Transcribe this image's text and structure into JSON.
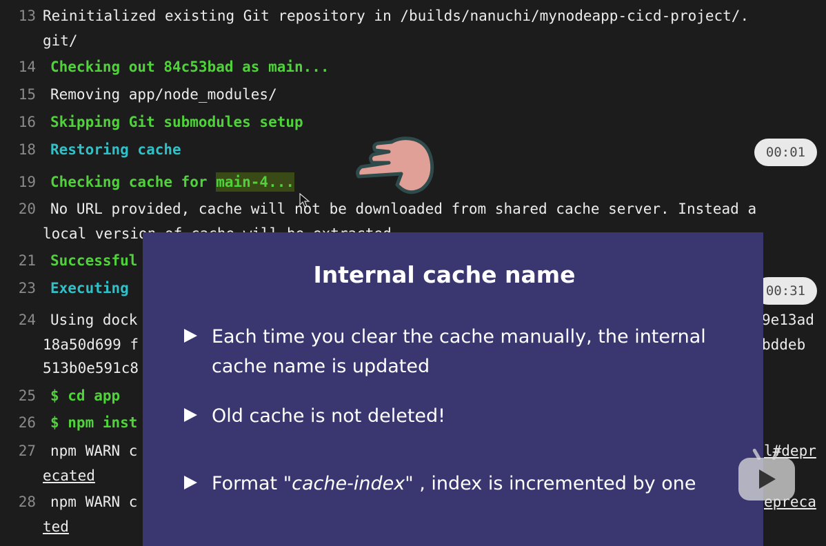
{
  "log": [
    {
      "n": "13",
      "text": "Reinitialized existing Git repository in /builds/nanuchi/mynodeapp-cicd-project/.",
      "cont": "git/",
      "style": "white"
    },
    {
      "n": "14",
      "text": "Checking out 84c53bad as main...",
      "style": "green"
    },
    {
      "n": "15",
      "text": "Removing app/node_modules/",
      "style": "white"
    },
    {
      "n": "16",
      "text": "Skipping Git submodules setup",
      "style": "green"
    },
    {
      "n": "18",
      "text": "Restoring cache",
      "style": "cyan",
      "badge": "00:01"
    },
    {
      "n": "19",
      "pre": "Checking cache for ",
      "hl": "main-4...",
      "style": "green"
    },
    {
      "n": "20",
      "text": "No URL provided, cache will not be downloaded from shared cache server. Instead a",
      "cont": "local version of cache will be extracted.",
      "style": "white"
    },
    {
      "n": "21",
      "text": "Successful",
      "style": "green"
    },
    {
      "n": "23",
      "text": "Executing",
      "style": "cyan",
      "badge": "00:31"
    },
    {
      "n": "24",
      "text": "Using dock",
      "right": "9e13ad",
      "cont": "18a50d699 f",
      "cont_right": "bddeb",
      "cont2": "513b0e591c8",
      "style": "white"
    },
    {
      "n": "25",
      "text": "$ cd app",
      "style": "green"
    },
    {
      "n": "26",
      "text": "$ npm inst",
      "style": "green"
    },
    {
      "n": "27",
      "text": "npm WARN c",
      "right": "l#depr",
      "cont": "ecated",
      "style": "white"
    },
    {
      "n": "28",
      "text": "npm WARN c",
      "right": "epreca",
      "cont": "ted",
      "style": "white"
    }
  ],
  "overlay": {
    "title": "Internal cache name",
    "b1": "Each time you clear the cache manually, the internal cache name is updated",
    "b2": "Old cache is not deleted!",
    "b3_pre": "Format \"",
    "b3_em": "cache-index",
    "b3_post": "\" , index is incremented by one"
  },
  "icons": {
    "pointer": "pointing-hand-icon",
    "play": "play-icon",
    "cursor": "mouse-cursor-icon"
  },
  "colors": {
    "green": "#4fd23a",
    "cyan": "#2fc0c8",
    "overlay": "#3a3670",
    "highlight": "#3a4a16"
  }
}
